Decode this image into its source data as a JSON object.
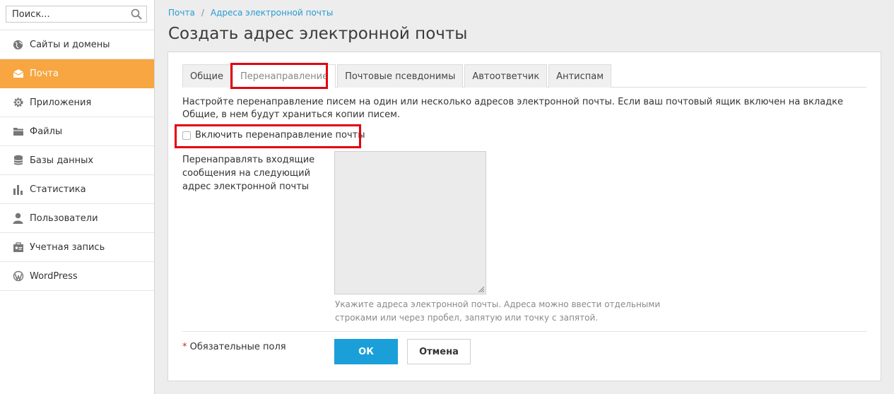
{
  "sidebar": {
    "search_placeholder": "Поиск...",
    "items": [
      {
        "label": "Сайты и домены",
        "icon": "globe-icon"
      },
      {
        "label": "Почта",
        "icon": "mail-icon",
        "active": true
      },
      {
        "label": "Приложения",
        "icon": "gear-icon"
      },
      {
        "label": "Файлы",
        "icon": "folder-icon"
      },
      {
        "label": "Базы данных",
        "icon": "database-icon"
      },
      {
        "label": "Статистика",
        "icon": "bar-chart-icon"
      },
      {
        "label": "Пользователи",
        "icon": "user-icon"
      },
      {
        "label": "Учетная запись",
        "icon": "account-icon"
      },
      {
        "label": "WordPress",
        "icon": "wordpress-icon"
      }
    ],
    "active_color": "#f7a641"
  },
  "breadcrumb": {
    "items": [
      "Почта",
      "Адреса электронной почты"
    ],
    "separator": "/"
  },
  "page": {
    "title": "Создать адрес электронной почты"
  },
  "tabs": [
    {
      "label": "Общие"
    },
    {
      "label": "Перенаправление",
      "active": true
    },
    {
      "label": "Почтовые псевдонимы"
    },
    {
      "label": "Автоответчик"
    },
    {
      "label": "Антиспам"
    }
  ],
  "form": {
    "intro": "Настройте перенаправление писем на один или несколько адресов электронной почты. Если ваш почтовый ящик включен на вкладке Общие, в нем будут храниться копии писем.",
    "enable_forwarding_label": "Включить перенаправление почты",
    "enable_forwarding_checked": false,
    "forward_label": "Перенаправлять входящие сообщения на следующий адрес электронной почты",
    "forward_value": "",
    "hint": "Укажите адреса электронной почты. Адреса можно ввести отдельными строками или через пробел, запятую или точку с запятой.",
    "required_star": "*",
    "required_note": "Обязательные поля",
    "ok_label": "ОК",
    "cancel_label": "Отмена"
  },
  "colors": {
    "primary_button": "#1a9fd8",
    "highlight_box": "#e3000f",
    "link": "#2a9bd2"
  }
}
